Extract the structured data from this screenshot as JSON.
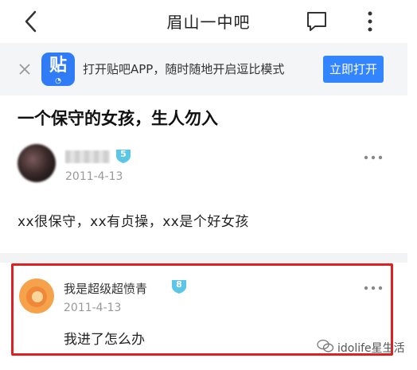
{
  "header": {
    "title": "眉山一中吧",
    "back_icon": "chevron-left-icon",
    "comment_icon": "comment-icon",
    "more_icon": "more-vertical-icon"
  },
  "app_banner": {
    "logo_text": "贴",
    "text": "打开贴吧APP，随时随地开启逗比模式",
    "open_button": "立即打开",
    "accent": "#3385ff"
  },
  "post": {
    "title": "一个保守的女孩，生人勿入",
    "author_level": "5",
    "date": "2011-4-13",
    "content": "xx很保守，xx有贞操，xx是个好女孩"
  },
  "reply": {
    "author": "我是超级超愤青",
    "level": "8",
    "date": "2011-4-13",
    "content": "我进了怎么办",
    "highlight_color": "#e02020"
  },
  "watermark": {
    "text": "idolife星生活"
  }
}
